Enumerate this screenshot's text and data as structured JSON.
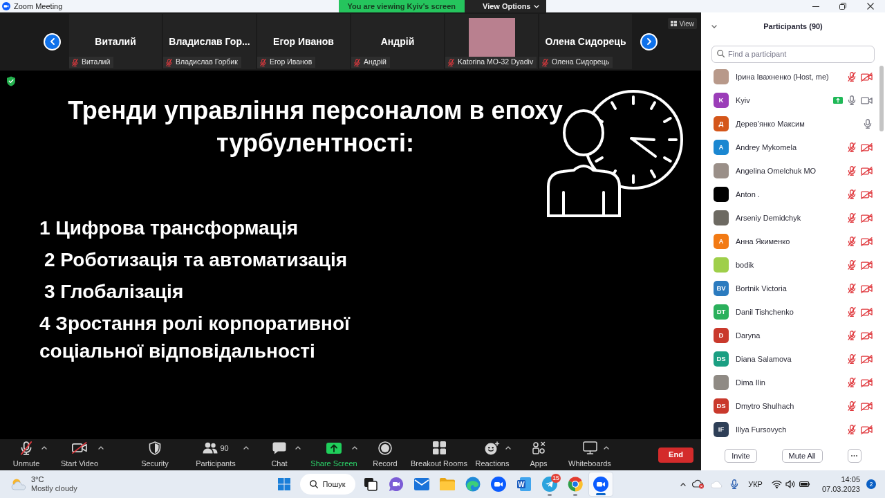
{
  "title_bar": {
    "title": "Zoom Meeting",
    "banner": "You are viewing Kyiv's screen",
    "view_options": "View Options"
  },
  "video_strip": {
    "view_button": "View",
    "tiles": [
      {
        "kind": "name",
        "name": "Виталий",
        "label": "Виталий",
        "muted": true
      },
      {
        "kind": "name",
        "name": "Владислав Гор...",
        "label": "Владислав Горбик",
        "muted": true
      },
      {
        "kind": "name",
        "name": "Егор Иванов",
        "label": "Егор Иванов",
        "muted": true
      },
      {
        "kind": "name",
        "name": "Андрій",
        "label": "Андрій",
        "muted": true
      },
      {
        "kind": "photo",
        "label": "Katorina MO-32 Dyadiv",
        "muted": true
      },
      {
        "kind": "name",
        "name": "Олена Сидорець",
        "label": "Олена Сидорець",
        "muted": true
      }
    ]
  },
  "shared_screen": {
    "title": "Тренди управління персоналом в епоху турбулентності:",
    "items": [
      {
        "text": "1 Цифрова трансформація",
        "indented": false
      },
      {
        "text": "2 Роботизація та автоматизація",
        "indented": true
      },
      {
        "text": "3 Глобалізація",
        "indented": true
      },
      {
        "text": "4 Зростання ролі корпоративної соціальної відповідальності",
        "indented": false
      }
    ]
  },
  "toolbar": {
    "buttons": [
      {
        "kind": "mic-off",
        "label": "Unmute",
        "caret": true
      },
      {
        "kind": "video-off",
        "label": "Start Video",
        "caret": true
      },
      {
        "kind": "security",
        "label": "Security",
        "caret": false
      },
      {
        "kind": "participants",
        "label": "Participants",
        "count": "90",
        "caret": true
      },
      {
        "kind": "chat",
        "label": "Chat",
        "caret": true
      },
      {
        "kind": "share",
        "label": "Share Screen",
        "caret": true
      },
      {
        "kind": "record",
        "label": "Record",
        "caret": false
      },
      {
        "kind": "breakout",
        "label": "Breakout Rooms",
        "caret": false
      },
      {
        "kind": "reactions",
        "label": "Reactions",
        "caret": true
      },
      {
        "kind": "apps",
        "label": "Apps",
        "caret": false
      },
      {
        "kind": "whiteboards",
        "label": "Whiteboards",
        "caret": true
      }
    ],
    "end_button": "End"
  },
  "participants_panel": {
    "title": "Participants (90)",
    "search": {
      "placeholder": "Find a participant"
    },
    "participants": [
      {
        "name": "Ірина Івахненко (Host, me)",
        "avatar": {
          "kind": "photo",
          "color": "#b8998a"
        },
        "sharing": false,
        "muted": true,
        "camera": true,
        "video_off": true
      },
      {
        "name": "Kyiv",
        "avatar": {
          "kind": "initials",
          "initials": "K",
          "color": "#9b3db8"
        },
        "sharing": true,
        "muted": false,
        "camera": true,
        "video_off": false
      },
      {
        "name": "Дерев’янко Максим",
        "avatar": {
          "kind": "initials",
          "initials": "Д",
          "color": "#d4561a"
        },
        "sharing": false,
        "muted": false,
        "camera": false
      },
      {
        "name": "Andrey Mykomela",
        "avatar": {
          "kind": "initials",
          "initials": "A",
          "color": "#1b87d1"
        },
        "sharing": false,
        "muted": true,
        "camera": true,
        "video_off": true
      },
      {
        "name": "Angelina Omelchuk MO",
        "avatar": {
          "kind": "photo",
          "color": "#9a8f88"
        },
        "sharing": false,
        "muted": true,
        "camera": true,
        "video_off": true
      },
      {
        "name": "Anton .",
        "avatar": {
          "kind": "photo",
          "color": "#000000"
        },
        "sharing": false,
        "muted": true,
        "camera": true,
        "video_off": true
      },
      {
        "name": "Arseniy Demidchyk",
        "avatar": {
          "kind": "photo",
          "color": "#6d6a62"
        },
        "sharing": false,
        "muted": true,
        "camera": true,
        "video_off": true
      },
      {
        "name": "Анна Якименко",
        "avatar": {
          "kind": "initials",
          "initials": "А",
          "color": "#f27a14"
        },
        "sharing": false,
        "muted": true,
        "camera": true,
        "video_off": true
      },
      {
        "name": "bodik",
        "avatar": {
          "kind": "photo",
          "color": "#9fcf4a"
        },
        "sharing": false,
        "muted": true,
        "camera": true,
        "video_off": true
      },
      {
        "name": "Bortnik Victoria",
        "avatar": {
          "kind": "initials",
          "initials": "BV",
          "color": "#2b7bbf"
        },
        "sharing": false,
        "muted": true,
        "camera": true,
        "video_off": true
      },
      {
        "name": "Danil Tishchenko",
        "avatar": {
          "kind": "initials",
          "initials": "DT",
          "color": "#2bb05c"
        },
        "sharing": false,
        "muted": true,
        "camera": true,
        "video_off": true
      },
      {
        "name": "Daryna",
        "avatar": {
          "kind": "initials",
          "initials": "D",
          "color": "#c9392c"
        },
        "sharing": false,
        "muted": true,
        "camera": true,
        "video_off": true
      },
      {
        "name": "Diana Salamova",
        "avatar": {
          "kind": "initials",
          "initials": "DS",
          "color": "#1a9f82"
        },
        "sharing": false,
        "muted": true,
        "camera": true,
        "video_off": true
      },
      {
        "name": "Dima Ilin",
        "avatar": {
          "kind": "photo",
          "color": "#8f8a84"
        },
        "sharing": false,
        "muted": true,
        "camera": true,
        "video_off": true
      },
      {
        "name": "Dmytro Shulhach",
        "avatar": {
          "kind": "initials",
          "initials": "DS",
          "color": "#c9392c"
        },
        "sharing": false,
        "muted": true,
        "camera": true,
        "video_off": true
      },
      {
        "name": "Illya Fursovych",
        "avatar": {
          "kind": "initials",
          "initials": "IF",
          "color": "#2e3f57"
        },
        "sharing": false,
        "muted": true,
        "camera": true,
        "video_off": true
      }
    ],
    "buttons": [
      "Invite",
      "Mute All"
    ]
  },
  "taskbar": {
    "weather": {
      "temperature": "3°C",
      "condition": "Mostly cloudy"
    },
    "search": {
      "label": "Пошук"
    },
    "apps": [
      {
        "kind": "task-view",
        "running": false,
        "selected": false
      },
      {
        "kind": "video-chat",
        "running": false,
        "selected": false
      },
      {
        "kind": "mail",
        "running": false,
        "selected": false
      },
      {
        "kind": "folder",
        "running": false,
        "selected": false
      },
      {
        "kind": "edge",
        "running": false,
        "selected": false
      },
      {
        "kind": "zoom",
        "running": false,
        "selected": false
      },
      {
        "kind": "word",
        "glyph": "W",
        "running": false,
        "selected": false
      },
      {
        "kind": "telegram",
        "badge": "15",
        "running": true,
        "selected": false
      },
      {
        "kind": "chrome",
        "running": true,
        "selected": false
      },
      {
        "kind": "zoom",
        "running": true,
        "selected": true
      }
    ],
    "language": "УКР",
    "time": "14:05",
    "date": "07.03.2023",
    "notifications": "2"
  }
}
